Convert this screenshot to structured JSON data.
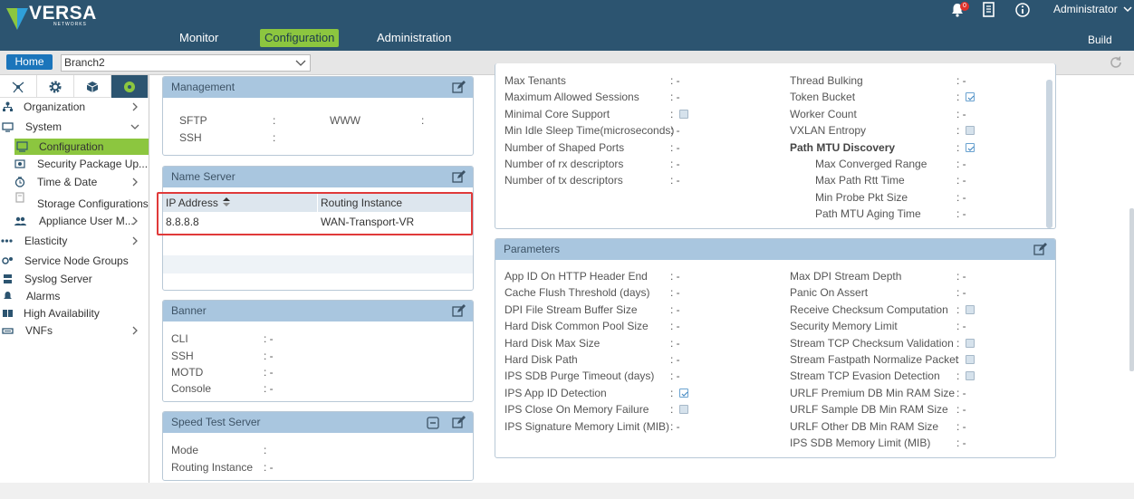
{
  "header": {
    "brand": "VERSA",
    "brand_sub": "NETWORKS",
    "nav": [
      "Monitor",
      "Configuration",
      "Administration"
    ],
    "build_label": "Build",
    "notification_count": "0",
    "user": "Administrator",
    "accent": "#8cc63f",
    "bar_color": "#2c5470"
  },
  "subbar": {
    "home_label": "Home",
    "branch_value": "Branch2"
  },
  "sidebar": {
    "items": [
      {
        "label": "Organization",
        "icon": "org-icon",
        "arrow": "right"
      },
      {
        "label": "System",
        "icon": "system-icon",
        "arrow": "down"
      },
      {
        "label": "Configuration",
        "icon": "config-icon",
        "selected": true
      },
      {
        "label": "Security Package Up...",
        "icon": "security-package-icon"
      },
      {
        "label": "Time & Date",
        "icon": "clock-icon",
        "arrow": "right"
      },
      {
        "label": "Storage Configurations",
        "icon": "storage-icon"
      },
      {
        "label": "Appliance User M...",
        "icon": "users-icon",
        "arrow": "right"
      },
      {
        "label": "Elasticity",
        "icon": "elasticity-icon",
        "arrow": "right"
      },
      {
        "label": "Service Node Groups",
        "icon": "service-node-icon"
      },
      {
        "label": "Syslog Server",
        "icon": "syslog-icon"
      },
      {
        "label": "Alarms",
        "icon": "alarm-icon"
      },
      {
        "label": "High Availability",
        "icon": "ha-icon"
      },
      {
        "label": "VNFs",
        "icon": "vnf-icon",
        "arrow": "right"
      }
    ]
  },
  "management": {
    "title": "Management",
    "sftp": "SFTP",
    "www": "WWW",
    "ssh": "SSH"
  },
  "name_server": {
    "title": "Name Server",
    "col_ip": "IP Address",
    "col_ri": "Routing Instance",
    "rows": [
      {
        "ip": "8.8.8.8",
        "ri": "WAN-Transport-VR"
      }
    ]
  },
  "banner": {
    "title": "Banner",
    "fields": [
      "CLI",
      "SSH",
      "MOTD",
      "Console"
    ],
    "values": [
      "-",
      "-",
      "-",
      "-"
    ]
  },
  "speed_test": {
    "title": "Speed Test Server",
    "fields": [
      "Mode",
      "Routing Instance"
    ],
    "values": [
      "",
      "-"
    ]
  },
  "top_panel": {
    "left": [
      {
        "label": "Max Tenants",
        "value": "-"
      },
      {
        "label": "Maximum Allowed Sessions",
        "value": "-"
      },
      {
        "label": "Minimal Core Support",
        "check": "off"
      },
      {
        "label": "Min Idle Sleep Time(microseconds)",
        "value": "-"
      },
      {
        "label": "Number of Shaped Ports",
        "value": "-"
      },
      {
        "label": "Number of rx descriptors",
        "value": "-"
      },
      {
        "label": "Number of tx descriptors",
        "value": "-"
      }
    ],
    "right": [
      {
        "label": "Thread Bulking",
        "value": "-"
      },
      {
        "label": "Token Bucket",
        "check": "on"
      },
      {
        "label": "Worker Count",
        "value": "-"
      },
      {
        "label": "VXLAN Entropy",
        "check": "off"
      },
      {
        "label": "Path MTU Discovery",
        "check": "on",
        "bold": true
      },
      {
        "label": "Max Converged Range",
        "value": "-",
        "indent": true
      },
      {
        "label": "Max Path Rtt Time",
        "value": "-",
        "indent": true
      },
      {
        "label": "Min Probe Pkt Size",
        "value": "-",
        "indent": true
      },
      {
        "label": "Path MTU Aging Time",
        "value": "-",
        "indent": true
      }
    ]
  },
  "parameters": {
    "title": "Parameters",
    "left": [
      {
        "label": "App ID On HTTP Header End",
        "value": "-"
      },
      {
        "label": "Cache Flush Threshold (days)",
        "value": "-"
      },
      {
        "label": "DPI File Stream Buffer Size",
        "value": "-"
      },
      {
        "label": "Hard Disk Common Pool Size",
        "value": "-"
      },
      {
        "label": "Hard Disk Max Size",
        "value": "-"
      },
      {
        "label": "Hard Disk Path",
        "value": "-"
      },
      {
        "label": "IPS SDB Purge Timeout (days)",
        "value": "-"
      },
      {
        "label": "IPS App ID Detection",
        "check": "on"
      },
      {
        "label": "IPS Close On Memory Failure",
        "check": "off"
      },
      {
        "label": "IPS Signature Memory Limit (MIB)",
        "value": "-"
      }
    ],
    "right": [
      {
        "label": "Max DPI Stream Depth",
        "value": "-"
      },
      {
        "label": "Panic On Assert",
        "value": "-"
      },
      {
        "label": "Receive Checksum Computation",
        "check": "off"
      },
      {
        "label": "Security Memory Limit",
        "value": "-"
      },
      {
        "label": "Stream TCP Checksum Validation",
        "check": "off"
      },
      {
        "label": "Stream Fastpath Normalize Packet",
        "check": "off"
      },
      {
        "label": "Stream TCP Evasion Detection",
        "check": "off"
      },
      {
        "label": "URLF Premium DB Min RAM Size",
        "value": "-"
      },
      {
        "label": "URLF Sample DB Min RAM Size",
        "value": "-"
      },
      {
        "label": "URLF Other DB Min RAM Size",
        "value": "-"
      },
      {
        "label": "IPS SDB Memory Limit (MIB)",
        "value": "-"
      }
    ]
  }
}
